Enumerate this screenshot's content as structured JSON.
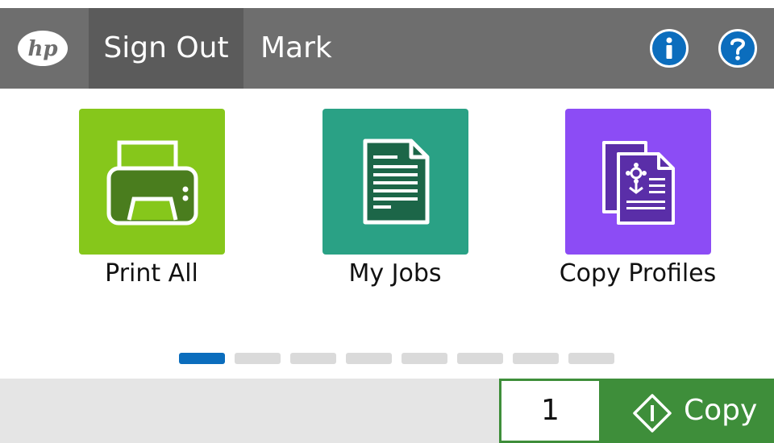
{
  "header": {
    "logo_text": "hp",
    "sign_out_label": "Sign Out",
    "user_name": "Mark",
    "info_icon": "info-icon",
    "help_icon": "help-icon"
  },
  "apps": [
    {
      "label": "Print All",
      "icon": "printer-icon",
      "color": "#86c71b"
    },
    {
      "label": "My Jobs",
      "icon": "document-icon",
      "color": "#2aa185"
    },
    {
      "label": "Copy Profiles",
      "icon": "copy-profiles-icon",
      "color": "#8c4cf5"
    }
  ],
  "pagination": {
    "pages": 8,
    "active_page": 1
  },
  "footer": {
    "copies_value": "1",
    "copy_label": "Copy",
    "copy_icon": "start-diamond-icon"
  },
  "colors": {
    "header_bg": "#6e6e6e",
    "sign_out_bg": "#5b5b5b",
    "accent_blue": "#0b6dbd",
    "copy_green": "#3e8e3a"
  }
}
